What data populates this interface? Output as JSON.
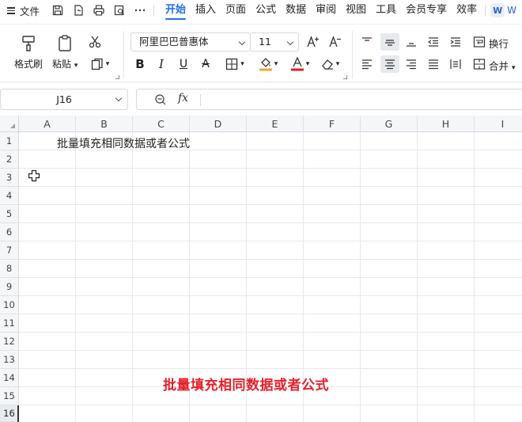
{
  "menubar": {
    "file_label": "文件",
    "tabs": [
      {
        "label": "开始",
        "active": true
      },
      {
        "label": "插入"
      },
      {
        "label": "页面"
      },
      {
        "label": "公式"
      },
      {
        "label": "数据"
      },
      {
        "label": "审阅"
      },
      {
        "label": "视图"
      },
      {
        "label": "工具"
      },
      {
        "label": "会员专享"
      },
      {
        "label": "效率"
      }
    ],
    "badge_letter": "W",
    "badge_text": "W"
  },
  "ribbon": {
    "format_painter": "格式刷",
    "paste": "粘贴",
    "font_name": "阿里巴巴普惠体",
    "font_size": "11",
    "wrap_text": "换行",
    "merge": "合并"
  },
  "formula_bar": {
    "name_box": "J16",
    "fx_symbol": "fx",
    "content": ""
  },
  "sheet": {
    "columns": [
      "A",
      "B",
      "C",
      "D",
      "E",
      "F",
      "G",
      "H",
      "I"
    ],
    "rows": [
      "1",
      "2",
      "3",
      "4",
      "5",
      "6",
      "7",
      "8",
      "9",
      "10",
      "11",
      "12",
      "13",
      "14",
      "15",
      "16"
    ],
    "cells": {
      "B1": "批量填充相同数据或者公式"
    },
    "active_cell": "J16"
  },
  "overlay_caption": "批量填充相同数据或者公式",
  "colors": {
    "accent": "#1f6feb",
    "caption_red": "#e8202a",
    "fill_yellow": "#f2a33a",
    "font_red": "#e02020"
  }
}
